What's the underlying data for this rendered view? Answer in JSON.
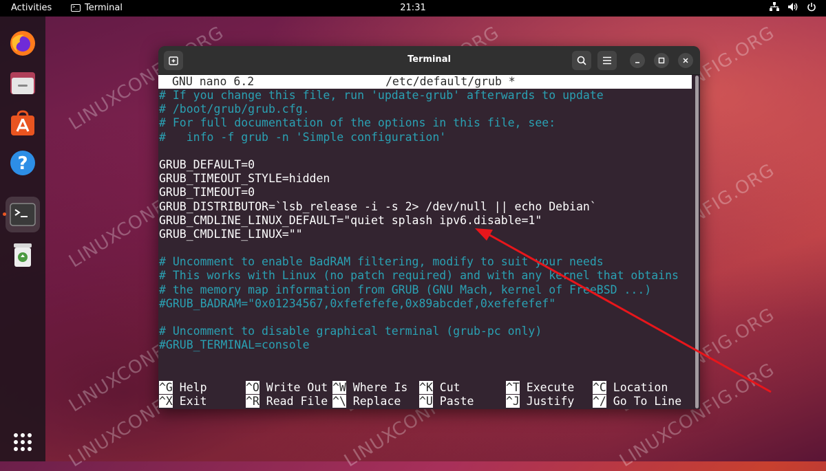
{
  "topbar": {
    "activities": "Activities",
    "app_name": "Terminal",
    "clock": "21:31",
    "tray_icons": [
      "network-icon",
      "volume-icon",
      "power-icon"
    ]
  },
  "dock": {
    "items": [
      {
        "name": "firefox",
        "icon": "firefox-icon"
      },
      {
        "name": "files",
        "icon": "files-icon"
      },
      {
        "name": "software",
        "icon": "software-icon"
      },
      {
        "name": "help",
        "icon": "help-icon"
      },
      {
        "name": "terminal",
        "icon": "terminal-icon",
        "active": true
      },
      {
        "name": "trash",
        "icon": "trash-icon"
      }
    ],
    "apps_grid_icon": "apps-grid-icon"
  },
  "window": {
    "title": "Terminal",
    "buttons": [
      "new-tab",
      "search",
      "menu",
      "minimize",
      "maximize",
      "close"
    ]
  },
  "nano": {
    "version": "GNU nano 6.2",
    "filename": "/etc/default/grub *",
    "lines": [
      {
        "text": "# If you change this file, run 'update-grub' afterwards to update",
        "comment": true
      },
      {
        "text": "# /boot/grub/grub.cfg.",
        "comment": true
      },
      {
        "text": "# For full documentation of the options in this file, see:",
        "comment": true
      },
      {
        "text": "#   info -f grub -n 'Simple configuration'",
        "comment": true
      },
      {
        "text": "",
        "comment": false
      },
      {
        "text": "GRUB_DEFAULT=0",
        "comment": false
      },
      {
        "text": "GRUB_TIMEOUT_STYLE=hidden",
        "comment": false
      },
      {
        "text": "GRUB_TIMEOUT=0",
        "comment": false
      },
      {
        "text": "GRUB_DISTRIBUTOR=`lsb_release -i -s 2> /dev/null || echo Debian`",
        "comment": false
      },
      {
        "text": "GRUB_CMDLINE_LINUX_DEFAULT=\"quiet splash ipv6.disable=1\"",
        "comment": false
      },
      {
        "text": "GRUB_CMDLINE_LINUX=\"\"",
        "comment": false
      },
      {
        "text": "",
        "comment": false
      },
      {
        "text": "# Uncomment to enable BadRAM filtering, modify to suit your needs",
        "comment": true
      },
      {
        "text": "# This works with Linux (no patch required) and with any kernel that obtains",
        "comment": true
      },
      {
        "text": "# the memory map information from GRUB (GNU Mach, kernel of FreeBSD ...)",
        "comment": true
      },
      {
        "text": "#GRUB_BADRAM=\"0x01234567,0xfefefefe,0x89abcdef,0xefefefef\"",
        "comment": true
      },
      {
        "text": "",
        "comment": false
      },
      {
        "text": "# Uncomment to disable graphical terminal (grub-pc only)",
        "comment": true
      },
      {
        "text": "#GRUB_TERMINAL=console",
        "comment": true
      }
    ],
    "shortcuts": [
      [
        {
          "key": "^G",
          "label": "Help"
        },
        {
          "key": "^O",
          "label": "Write Out"
        },
        {
          "key": "^W",
          "label": "Where Is"
        },
        {
          "key": "^K",
          "label": "Cut"
        },
        {
          "key": "^T",
          "label": "Execute"
        },
        {
          "key": "^C",
          "label": "Location"
        }
      ],
      [
        {
          "key": "^X",
          "label": "Exit"
        },
        {
          "key": "^R",
          "label": "Read File"
        },
        {
          "key": "^\\",
          "label": "Replace"
        },
        {
          "key": "^U",
          "label": "Paste"
        },
        {
          "key": "^J",
          "label": "Justify"
        },
        {
          "key": "^/",
          "label": "Go To Line"
        }
      ]
    ]
  },
  "watermark": "LINUXCONFIG.ORG",
  "colors": {
    "comment": "#2aa1b3",
    "accent": "#e95420",
    "arrow": "#e8161b"
  }
}
